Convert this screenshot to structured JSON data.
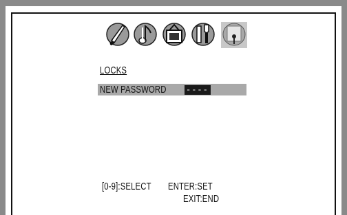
{
  "menu": {
    "icons": [
      "picture-settings-icon",
      "sound-settings-icon",
      "tv-settings-icon",
      "tools-settings-icon",
      "lock-settings-icon"
    ],
    "title": "LOCKS",
    "password_label": "NEW PASSWORD",
    "password_value": "----"
  },
  "hints": {
    "select": "[0-9]:SELECT",
    "set": "ENTER:SET",
    "exit": "EXIT:END"
  },
  "colors": {
    "frame": "#8a8a8a",
    "highlight": "#a9a9a9",
    "field": "#1a1a1a"
  }
}
